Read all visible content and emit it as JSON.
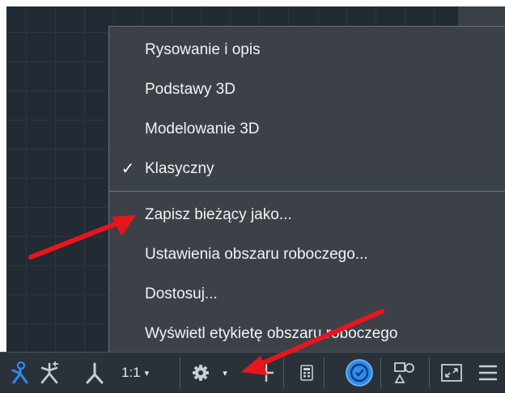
{
  "workspace_menu": {
    "items": [
      {
        "label": "Rysowanie i opis",
        "checked": false
      },
      {
        "label": "Podstawy 3D",
        "checked": false
      },
      {
        "label": "Modelowanie 3D",
        "checked": false
      },
      {
        "label": "Klasyczny",
        "checked": true
      }
    ],
    "actions": [
      {
        "label": "Zapisz bieżący jako..."
      },
      {
        "label": "Ustawienia obszaru roboczego..."
      },
      {
        "label": "Dostosuj..."
      },
      {
        "label": "Wyświetl etykietę obszaru roboczego"
      }
    ],
    "check_glyph": "✓"
  },
  "statusbar": {
    "annotation_scale": "1:1",
    "caret": "▾",
    "icons": [
      "annotation-visibility-icon",
      "auto-scale-icon",
      "annotation-scale-icon",
      "workspace-gear-icon",
      "plus-icon",
      "calculator-icon",
      "isolate-objects-icon",
      "graphics-performance-icon",
      "fullscreen-icon",
      "customize-menu-icon"
    ]
  },
  "colors": {
    "annotation_accent": "#2d8cf0",
    "arrow": "#e8161c",
    "menu_bg": "#3c4148",
    "canvas_bg": "#222a34"
  }
}
